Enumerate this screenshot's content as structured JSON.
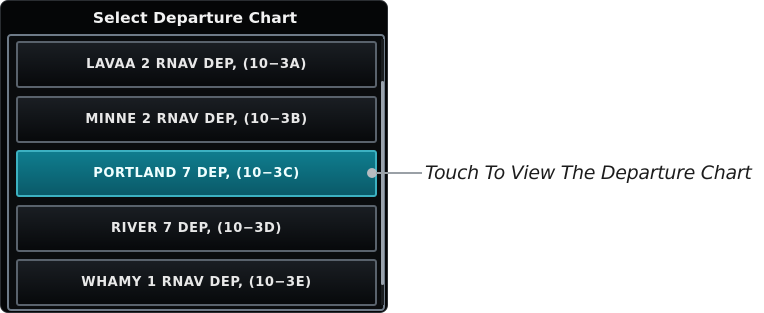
{
  "window": {
    "title": "Select Departure Chart"
  },
  "departure_list": {
    "items": [
      {
        "label": "LAVAA 2 RNAV DEP, (10−3A)",
        "selected": false
      },
      {
        "label": "MINNE 2 RNAV DEP, (10−3B)",
        "selected": false
      },
      {
        "label": "PORTLAND 7 DEP, (10−3C)",
        "selected": true
      },
      {
        "label": "RIVER 7 DEP, (10−3D)",
        "selected": false
      },
      {
        "label": "WHAMY 1 RNAV DEP, (10−3E)",
        "selected": false
      }
    ]
  },
  "callout": {
    "text": "Touch To View The Departure Chart"
  },
  "colors": {
    "selected_item": "#0f7d8e",
    "item_border": "#59626c",
    "frame_border": "#6e7a87",
    "background": "#050607"
  }
}
